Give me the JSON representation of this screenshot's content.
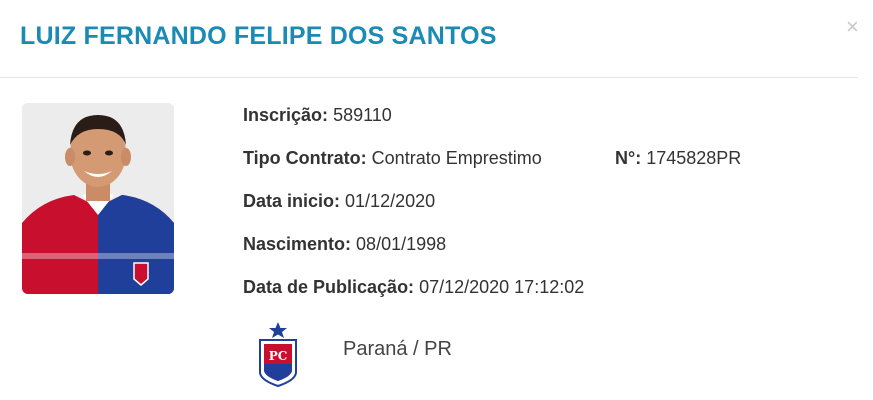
{
  "player": {
    "name": "LUIZ FERNANDO FELIPE DOS SANTOS"
  },
  "close_label": "×",
  "fields": {
    "inscricao_label": "Inscrição:",
    "inscricao_value": "589110",
    "tipo_contrato_label": "Tipo Contrato:",
    "tipo_contrato_value": "Contrato Emprestimo",
    "numero_label": "N°:",
    "numero_value": "1745828PR",
    "data_inicio_label": "Data inicio:",
    "data_inicio_value": "01/12/2020",
    "nascimento_label": "Nascimento:",
    "nascimento_value": "08/01/1998",
    "publicacao_label": "Data de Publicação:",
    "publicacao_value": "07/12/2020 17:12:02"
  },
  "club": {
    "name": "Paraná / PR",
    "crest_icon": "parana-clube-crest-icon"
  },
  "colors": {
    "title": "#1a8bb5",
    "jersey_red": "#c8102e",
    "jersey_blue": "#1f3f9a"
  }
}
